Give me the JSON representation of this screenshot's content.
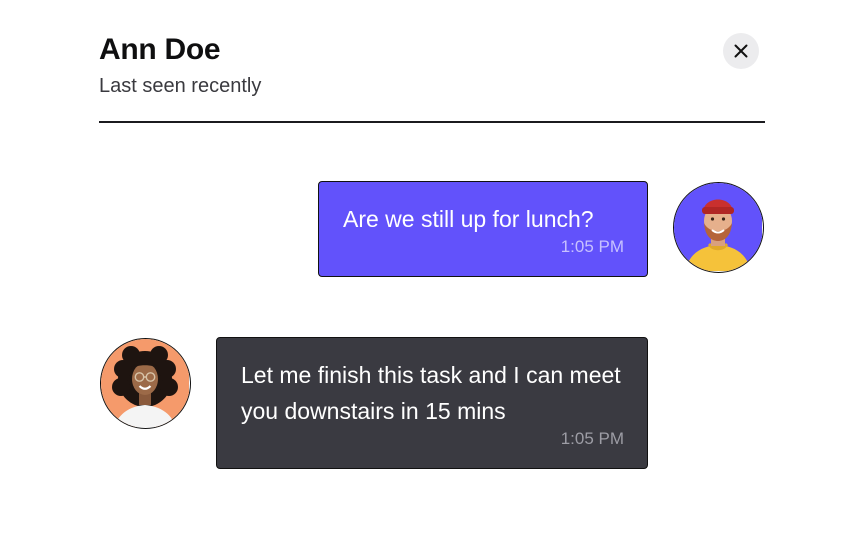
{
  "header": {
    "title": "Ann Doe",
    "status": "Last seen recently",
    "close_icon": "close-icon"
  },
  "messages": [
    {
      "direction": "outgoing",
      "text": "Are we still up for lunch?",
      "time": "1:05 PM",
      "bubble_color": "#6252fb",
      "avatar": "man-avatar"
    },
    {
      "direction": "incoming",
      "text": "Let me finish this task and I can meet you downstairs in 15 mins",
      "time": "1:05 PM",
      "bubble_color": "#3a3a41",
      "avatar": "woman-avatar"
    }
  ],
  "colors": {
    "outgoing_bubble": "#6252fb",
    "incoming_bubble": "#3a3a41",
    "outgoing_avatar_bg": "#6252fb",
    "incoming_avatar_bg": "#f59a6b",
    "close_button_bg": "#ececee"
  }
}
